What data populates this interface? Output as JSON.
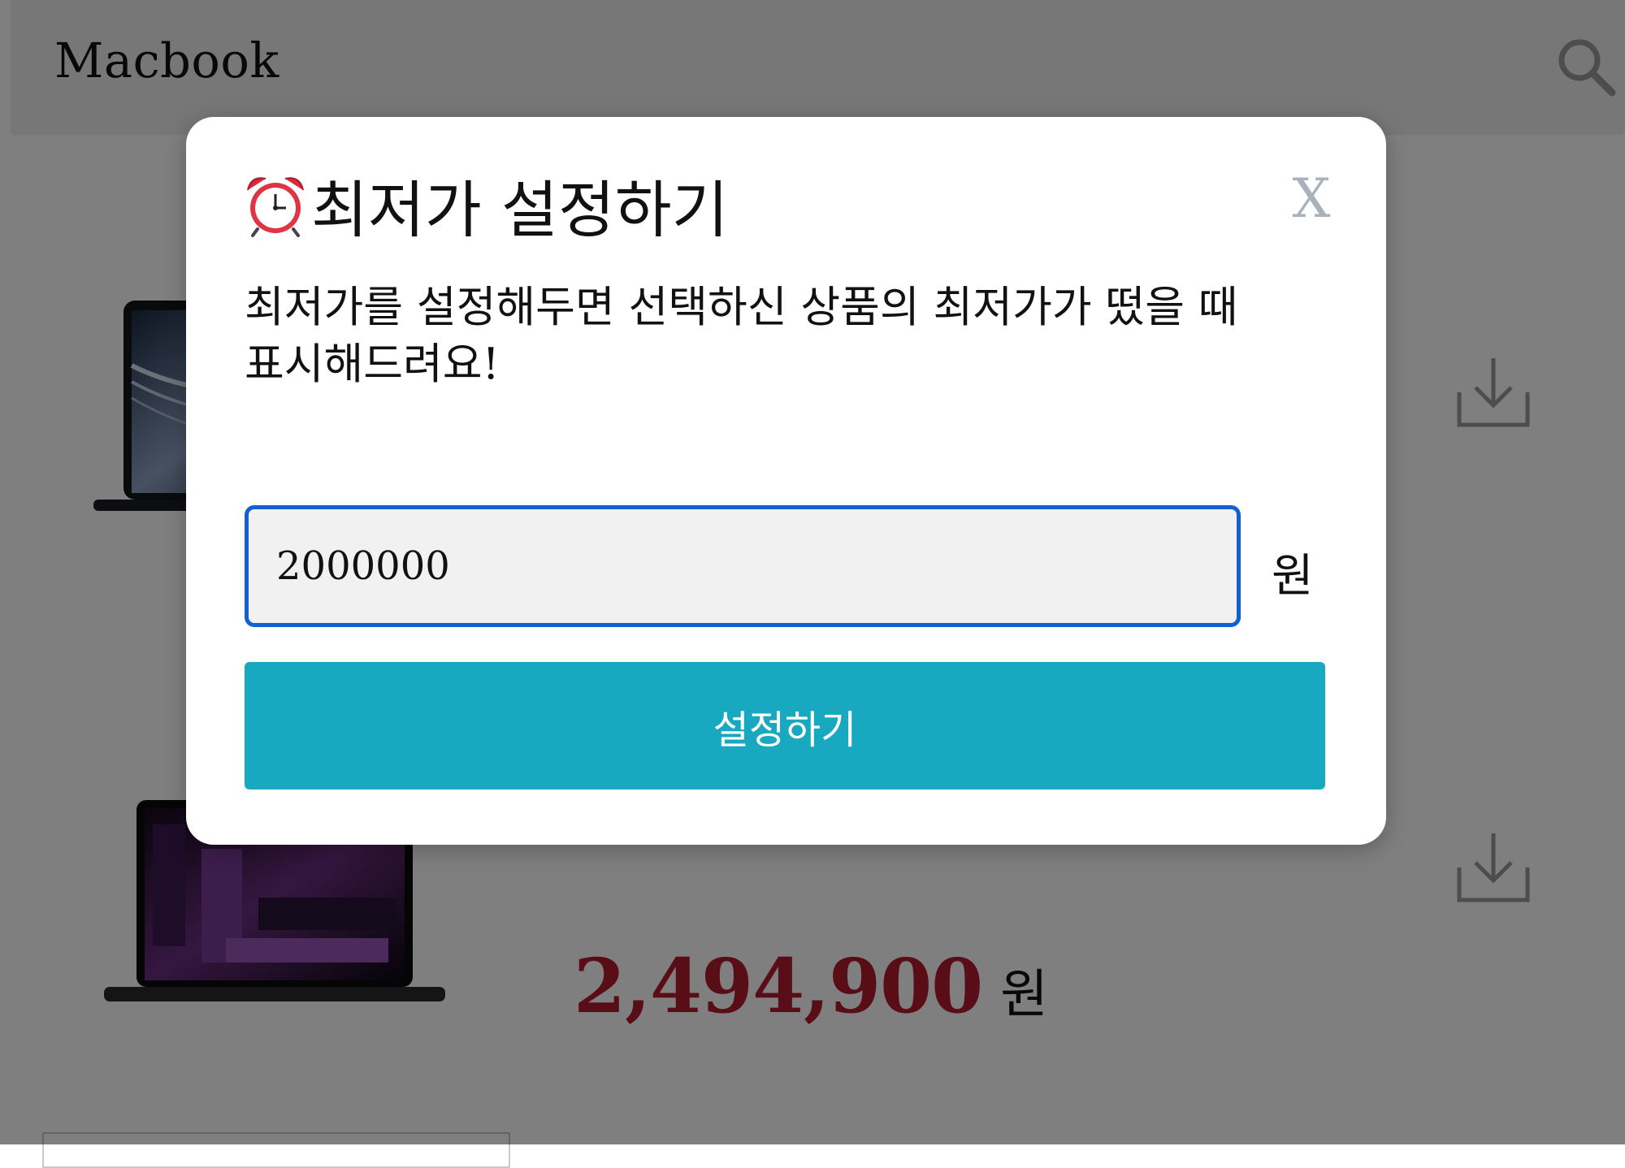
{
  "header": {
    "title": "Macbook",
    "search_icon": "search-icon"
  },
  "products": [
    {
      "image": "macbook-air-image",
      "download_icon": "download-icon"
    },
    {
      "image": "macbook-pro-image",
      "price": "2,494,900",
      "price_unit": "원",
      "download_icon": "download-icon"
    }
  ],
  "modal": {
    "icon": "alarm-clock-icon",
    "title": "최저가 설정하기",
    "close_label": "X",
    "description": "최저가를 설정해두면 선택하신 상품의 최저가가 떴을 때\n표시해드려요!",
    "input_value": "2000000",
    "input_unit": "원",
    "submit_label": "설정하기"
  },
  "colors": {
    "price": "#b31b2c",
    "accent_button": "#18a9c0",
    "input_border": "#1160d6",
    "overlay": "rgba(0,0,0,0.5)"
  }
}
